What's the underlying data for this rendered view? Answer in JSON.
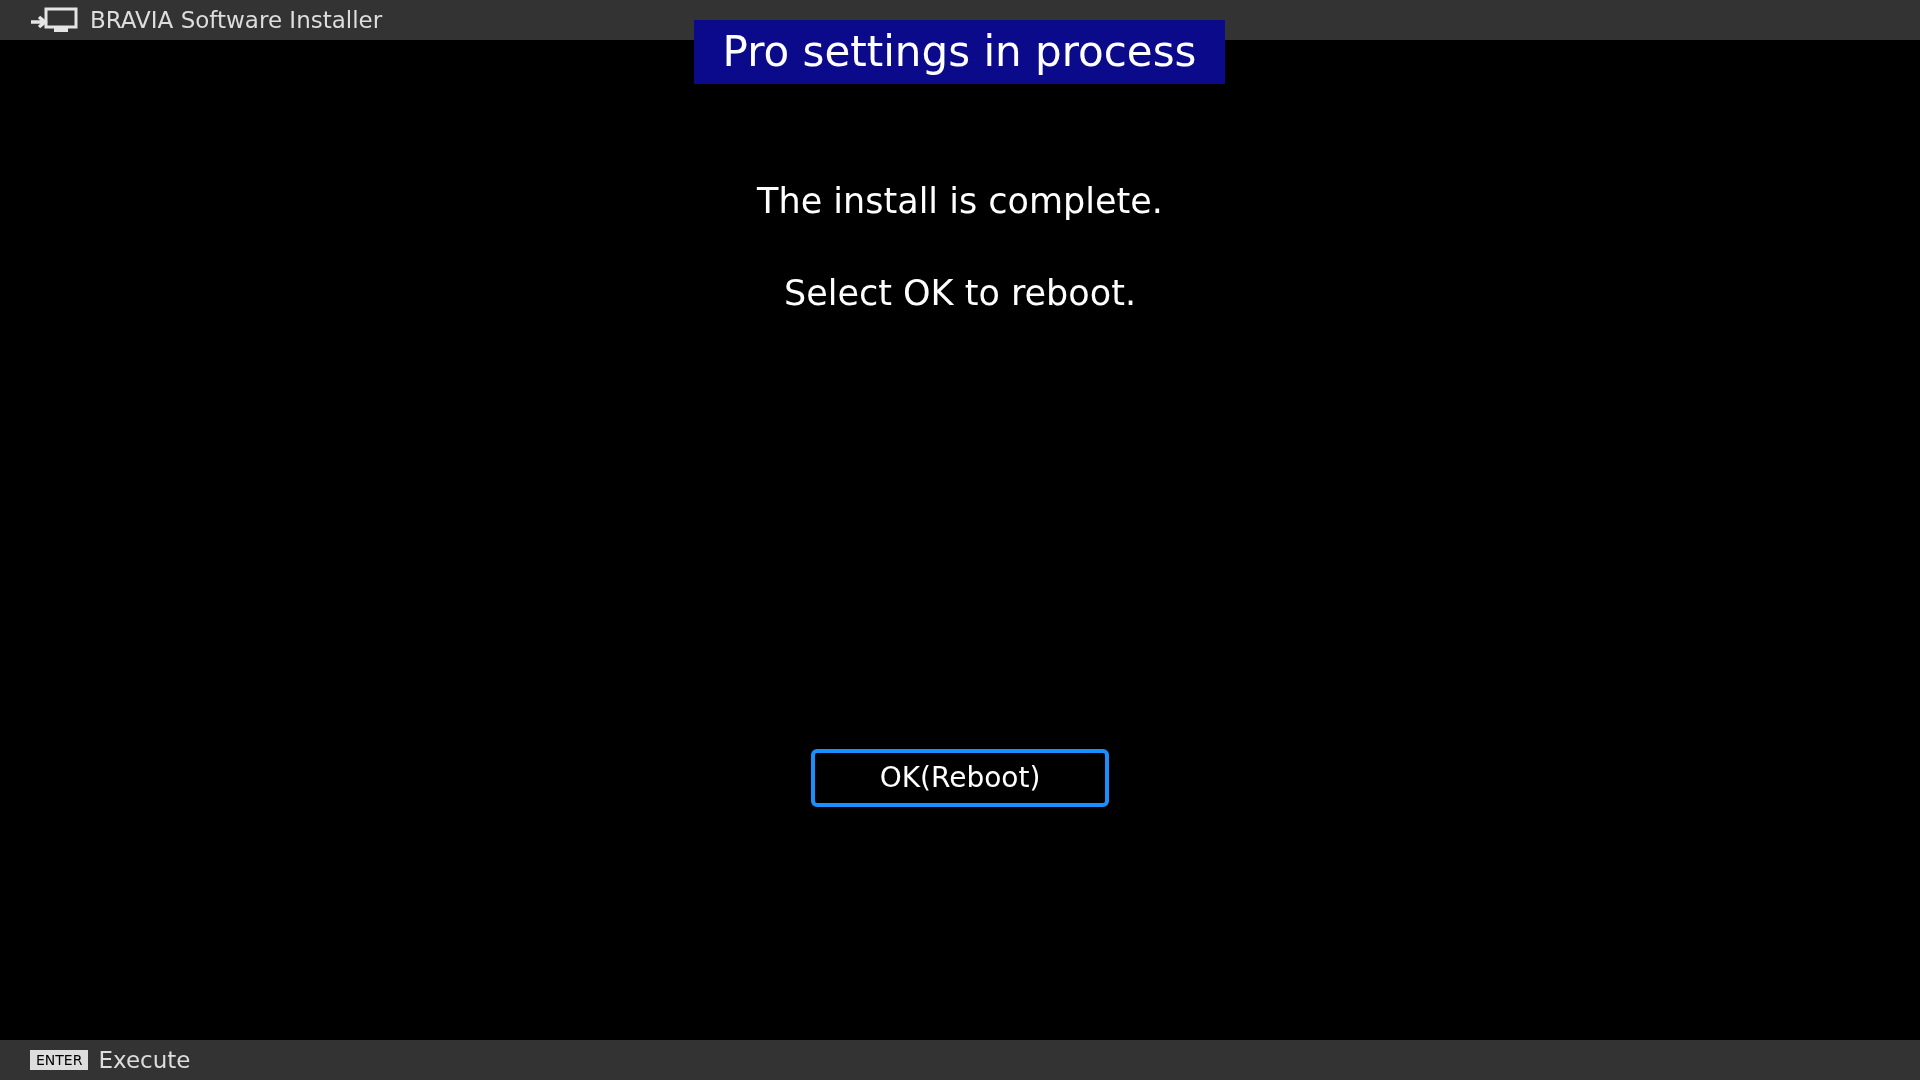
{
  "app_bar": {
    "title": "BRAVIA Software Installer"
  },
  "banner": {
    "title": "Pro settings in process"
  },
  "messages": [
    "The install is complete.",
    "Select OK to reboot."
  ],
  "button": {
    "label": "OK(Reboot)",
    "focused": true
  },
  "hint_bar": {
    "key": "ENTER",
    "action": "Execute"
  }
}
